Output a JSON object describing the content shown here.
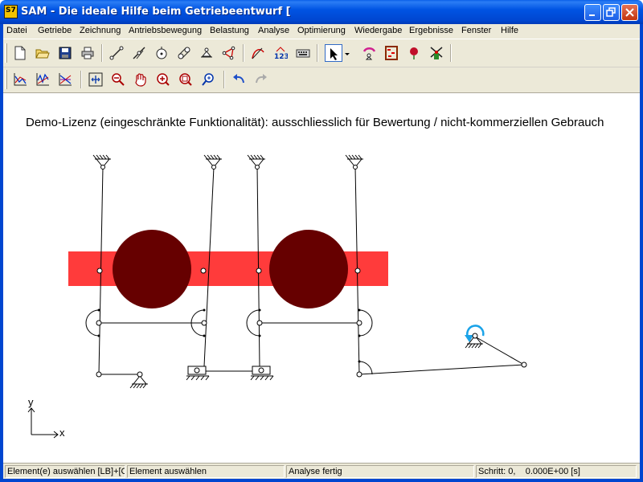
{
  "window": {
    "title": "SAM - Die ideale Hilfe beim Getriebeentwurf [",
    "icon_label": "S7",
    "controls": [
      "minimize-icon",
      "maximize-icon",
      "close-icon"
    ]
  },
  "menu": {
    "items": [
      "Datei",
      "Getriebe",
      "Zeichnung",
      "Antriebsbewegung",
      "Belastung",
      "Analyse",
      "Optimierung",
      "Wiedergabe",
      "Ergebnisse",
      "Fenster",
      "Hilfe"
    ]
  },
  "toolbar": {
    "row1": [
      "new-file-icon",
      "open-folder-icon",
      "save-icon",
      "print-icon",
      "beam-element-icon",
      "slider-element-icon",
      "gear-element-icon",
      "chain-element-icon",
      "hinge-support-icon",
      "triangle-element-icon",
      "spline-curve-icon",
      "numbering-123-icon",
      "keyboard-input-icon",
      "select-arrow-icon",
      "dropdown-arrow-icon",
      "motion-drive-icon",
      "abacus-results-icon",
      "rose-icon",
      "windmill-icon"
    ],
    "row2": [
      "graph-plot-1-icon",
      "graph-plot-2-icon",
      "graph-plot-3-icon",
      "fit-view-icon",
      "zoom-out-icon",
      "pan-hand-icon",
      "zoom-in-icon",
      "zoom-window-icon",
      "zoom-dynamic-icon",
      "undo-icon",
      "redo-icon"
    ],
    "numbering_label": "123"
  },
  "canvas": {
    "demo_notice": "Demo-Lizenz (eingeschränkte Funktionalität): ausschliesslich für Bewertung / nicht-kommerziellen Gebrauch",
    "axis_x_label": "x",
    "axis_y_label": "y",
    "colors": {
      "belt": "#ff3b3b",
      "wheel": "#660000",
      "linkage": "#000000",
      "drive_marker": "#1aa3e8"
    }
  },
  "status": {
    "selection_hint": "Element(e) auswählen [LB]+[C",
    "mode": "Element auswählen",
    "analysis": "Analyse fertig",
    "step": "Schritt: 0,",
    "time": "0.000E+00 [s]"
  }
}
